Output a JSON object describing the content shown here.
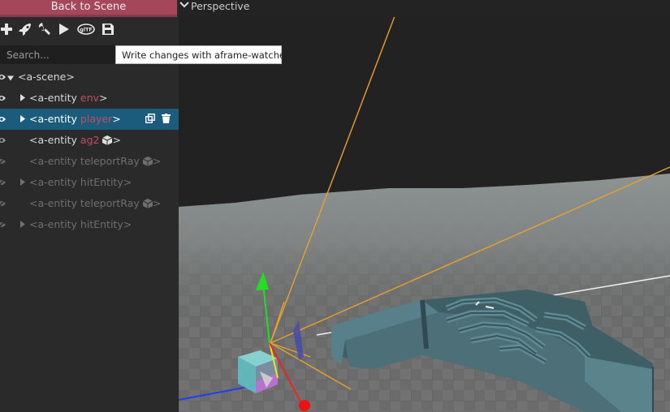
{
  "left_panel": {
    "back_button": "Back to Scene",
    "toolbar": {
      "add": "plus-icon",
      "export": "rocket-icon",
      "inspect": "wrench-icon",
      "play": "play-icon",
      "gltf": "gltf-icon",
      "save": "floppy-disk-icon"
    },
    "search_placeholder": "Search...",
    "tooltip": "Write changes with aframe-watcher.",
    "tree": [
      {
        "tag_open": "<a-scene>"
      },
      {
        "tag_open": "<a-entity",
        "id": "env",
        "tag_close": ">"
      },
      {
        "tag_open": "<a-entity",
        "id": "player",
        "tag_close": ">"
      },
      {
        "tag_open": "<a-entity",
        "id": "ag2",
        "tag_close": ">"
      },
      {
        "tag_open": "<a-entity",
        "component": "teleportRay",
        "tag_close": ">"
      },
      {
        "tag_open": "<a-entity",
        "component": "hitEntity",
        "tag_close": ">"
      },
      {
        "tag_open": "<a-entity",
        "component": "teleportRay",
        "tag_close": ">"
      },
      {
        "tag_open": "<a-entity",
        "component": "hitEntity",
        "tag_close": ">"
      }
    ]
  },
  "viewport": {
    "camera": "Perspective"
  },
  "colors": {
    "accent": "#a4475a",
    "selected_row": "#1b5b7c",
    "entity_id": "#c24e61",
    "ray": "#e8a030",
    "maze_wall": "#4d6f77"
  }
}
